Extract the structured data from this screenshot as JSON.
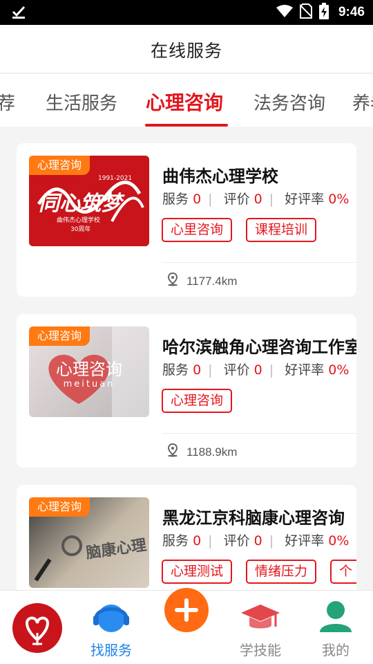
{
  "status_bar": {
    "time": "9:46"
  },
  "header": {
    "title": "在线服务"
  },
  "tabs": [
    {
      "label": "荐"
    },
    {
      "label": "生活服务"
    },
    {
      "label": "心理咨询"
    },
    {
      "label": "法务咨询"
    },
    {
      "label": "养老"
    }
  ],
  "active_tab": "心理咨询",
  "labels": {
    "service": "服务",
    "review": "评价",
    "rate": "好评率"
  },
  "cards": [
    {
      "badge": "心理咨询",
      "name": "曲伟杰心理学校",
      "service_count": "0",
      "review_count": "0",
      "good_rate": "0%",
      "tags": [
        "心里咨询",
        "课程培训"
      ],
      "distance": "1177.4km",
      "thumb_text": "同心筑梦",
      "thumb_sub1": "1991-2021",
      "thumb_sub2": "曲伟杰心理学校",
      "thumb_sub3": "30周年"
    },
    {
      "badge": "心理咨询",
      "name": "哈尔滨触角心理咨询工作室",
      "service_count": "0",
      "review_count": "0",
      "good_rate": "0%",
      "tags": [
        "心理咨询"
      ],
      "distance": "1188.9km",
      "thumb_text": "心理咨询",
      "thumb_sub1": "meituan"
    },
    {
      "badge": "心理咨询",
      "name": "黑龙江京科脑康心理咨询",
      "service_count": "0",
      "review_count": "0",
      "good_rate": "0%",
      "tags": [
        "心理测试",
        "情绪压力",
        "个"
      ],
      "thumb_text": "脑康心理"
    }
  ],
  "bottom_nav": {
    "find_service": "找服务",
    "learn_skill": "学技能",
    "mine": "我的"
  },
  "colors": {
    "accent": "#e4161d",
    "badge": "#ff7a12",
    "nav_active": "#1f82e8",
    "fab": "#ff6a12"
  }
}
